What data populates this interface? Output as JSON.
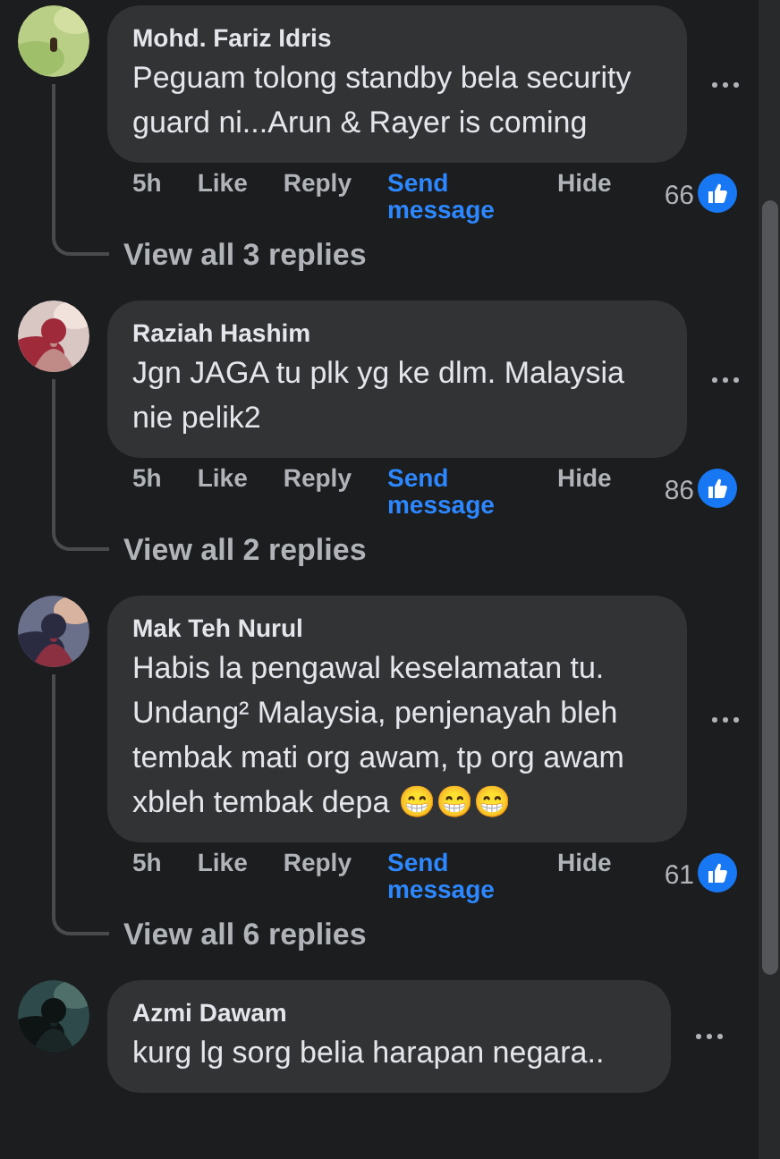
{
  "comments": [
    {
      "author": "Mohd. Fariz Idris",
      "text": "Peguam tolong standby bela security guard ni...Arun & Rayer is coming",
      "actions": [
        {
          "label": "5h",
          "kind": "time"
        },
        {
          "label": "Like",
          "kind": "plain"
        },
        {
          "label": "Reply",
          "kind": "plain"
        },
        {
          "label": "Send message",
          "kind": "link"
        },
        {
          "label": "Hide",
          "kind": "plain"
        }
      ],
      "reaction_count": "66",
      "replies_link": "View all 3 replies"
    },
    {
      "author": "Raziah Hashim",
      "text": "Jgn JAGA tu plk yg ke dlm. Malaysia nie pelik2",
      "actions": [
        {
          "label": "5h",
          "kind": "time"
        },
        {
          "label": "Like",
          "kind": "plain"
        },
        {
          "label": "Reply",
          "kind": "plain"
        },
        {
          "label": "Send message",
          "kind": "link"
        },
        {
          "label": "Hide",
          "kind": "plain"
        }
      ],
      "reaction_count": "86",
      "replies_link": "View all 2 replies"
    },
    {
      "author": "Mak Teh Nurul",
      "text": "Habis la pengawal keselamatan tu. Undang² Malaysia, penjenayah bleh tembak mati org awam, tp org awam xbleh tembak depa 😁😁😁",
      "actions": [
        {
          "label": "5h",
          "kind": "time"
        },
        {
          "label": "Like",
          "kind": "plain"
        },
        {
          "label": "Reply",
          "kind": "plain"
        },
        {
          "label": "Send message",
          "kind": "link"
        },
        {
          "label": "Hide",
          "kind": "plain"
        }
      ],
      "reaction_count": "61",
      "replies_link": "View all 6 replies"
    },
    {
      "author": "Azmi Dawam",
      "text": "kurg lg sorg belia harapan negara.."
    }
  ]
}
